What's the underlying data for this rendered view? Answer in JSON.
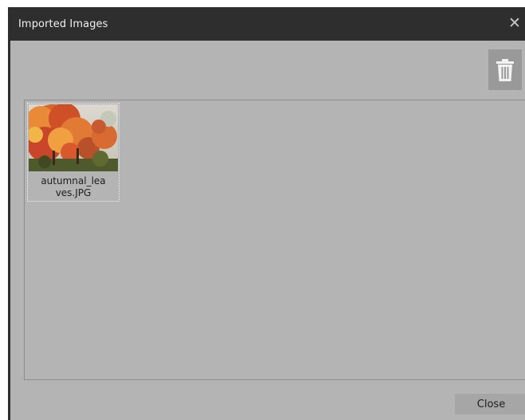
{
  "window": {
    "title": "Imported Images",
    "close_glyph": "✕"
  },
  "toolbar": {
    "delete_icon": "trash-icon"
  },
  "images": [
    {
      "filename_line1": "autumnal_lea",
      "filename_line2": "ves.JPG",
      "thumbnail_description_icon": "image-thumbnail"
    }
  ],
  "footer": {
    "close_label": "Close"
  },
  "colors": {
    "titlebar": "#2e2e2e",
    "dialog_bg": "#b4b4b4",
    "button_bg": "#a6a6a6",
    "delete_bg": "#999999"
  }
}
